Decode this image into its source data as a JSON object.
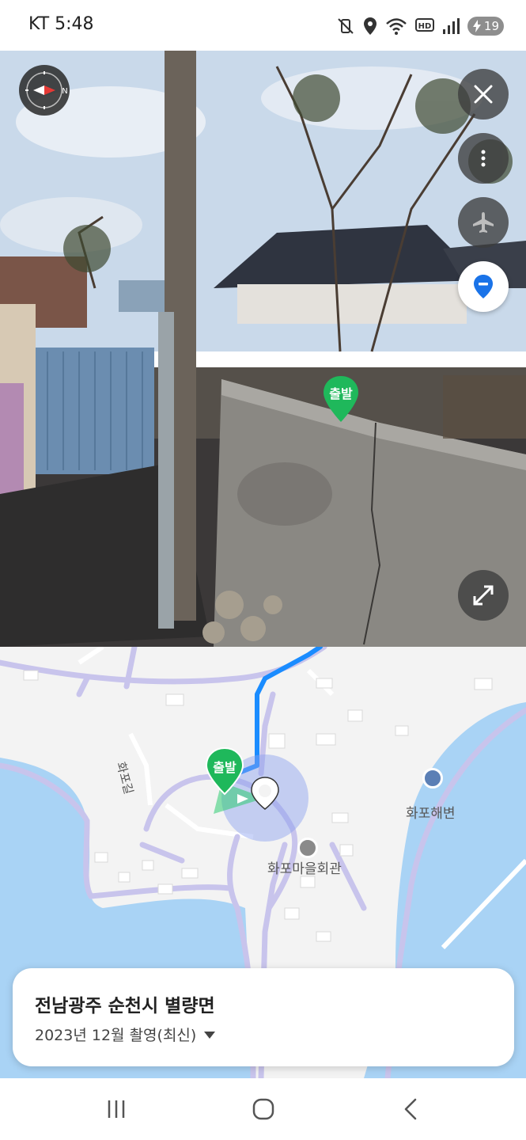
{
  "status_bar": {
    "carrier_time": "KT 5:48",
    "battery_level": "19",
    "icons": [
      "mute-vibrate-icon",
      "location-icon",
      "wifi-icon",
      "hd-voice-icon",
      "signal-icon",
      "battery-icon"
    ]
  },
  "street_view": {
    "icons": [
      "compass-icon",
      "close-icon",
      "more-icon",
      "airplane-icon",
      "location-pin-icon",
      "expand-icon"
    ],
    "start_marker_label": "출발"
  },
  "map": {
    "start_marker_label": "출발",
    "road_label": "화포길",
    "poi_beach": "화포해변",
    "poi_hall": "화포마을회관",
    "colors": {
      "water": "#a9d3f5",
      "land": "#f3f3f3",
      "road": "#c8c4ec",
      "route": "#1a8cff",
      "marker": "#1fb85b"
    }
  },
  "info_card": {
    "title": "전남광주 순천시 별량면",
    "date": "2023년 12월 촬영(최신)"
  },
  "nav_bar": {
    "icons": [
      "recent-apps-icon",
      "home-icon",
      "back-icon"
    ]
  }
}
